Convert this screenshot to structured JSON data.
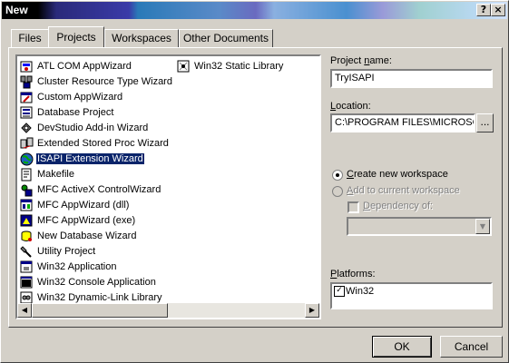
{
  "window": {
    "title": "New",
    "help_glyph": "?",
    "close_glyph": "×"
  },
  "tabs": [
    {
      "label": "Files",
      "active": false
    },
    {
      "label": "Projects",
      "active": true
    },
    {
      "label": "Workspaces",
      "active": false
    },
    {
      "label": "Other Documents",
      "active": false
    }
  ],
  "projects": {
    "items": [
      {
        "label": "ATL COM AppWizard",
        "icon": "atl-com-icon"
      },
      {
        "label": "Cluster Resource Type Wizard",
        "icon": "cluster-icon"
      },
      {
        "label": "Custom AppWizard",
        "icon": "custom-wizard-icon"
      },
      {
        "label": "Database Project",
        "icon": "database-icon"
      },
      {
        "label": "DevStudio Add-in Wizard",
        "icon": "addin-icon"
      },
      {
        "label": "Extended Stored Proc Wizard",
        "icon": "stored-proc-icon"
      },
      {
        "label": "ISAPI Extension Wizard",
        "icon": "globe-icon",
        "selected": true
      },
      {
        "label": "Makefile",
        "icon": "makefile-icon"
      },
      {
        "label": "MFC ActiveX ControlWizard",
        "icon": "activex-icon"
      },
      {
        "label": "MFC AppWizard (dll)",
        "icon": "mfc-dll-icon"
      },
      {
        "label": "MFC AppWizard (exe)",
        "icon": "mfc-exe-icon"
      },
      {
        "label": "New Database Wizard",
        "icon": "new-database-icon"
      },
      {
        "label": "Utility Project",
        "icon": "utility-icon"
      },
      {
        "label": "Win32 Application",
        "icon": "win32-app-icon"
      },
      {
        "label": "Win32 Console Application",
        "icon": "console-icon"
      },
      {
        "label": "Win32 Dynamic-Link Library",
        "icon": "dll-icon"
      },
      {
        "label": "Win32 Static Library",
        "icon": "static-lib-icon"
      }
    ],
    "scroll_left_glyph": "◀",
    "scroll_right_glyph": "▶"
  },
  "project_name": {
    "label_pre": "Project ",
    "label_key": "n",
    "label_post": "ame:",
    "value": "TryISAPI"
  },
  "location": {
    "label_key": "L",
    "label_post": "ocation:",
    "value": "C:\\PROGRAM FILES\\MICROSO",
    "browse_label": "..."
  },
  "workspace": {
    "create_key": "C",
    "create_post": "reate new workspace",
    "add_key": "A",
    "add_post": "dd to current workspace",
    "dependency_key": "D",
    "dependency_post": "ependency of:",
    "combo_arrow_glyph": "▼"
  },
  "platforms": {
    "label_key": "P",
    "label_post": "latforms:",
    "items": [
      {
        "label": "Win32",
        "checked": true
      }
    ]
  },
  "footer": {
    "ok_label": "OK",
    "cancel_label": "Cancel"
  }
}
